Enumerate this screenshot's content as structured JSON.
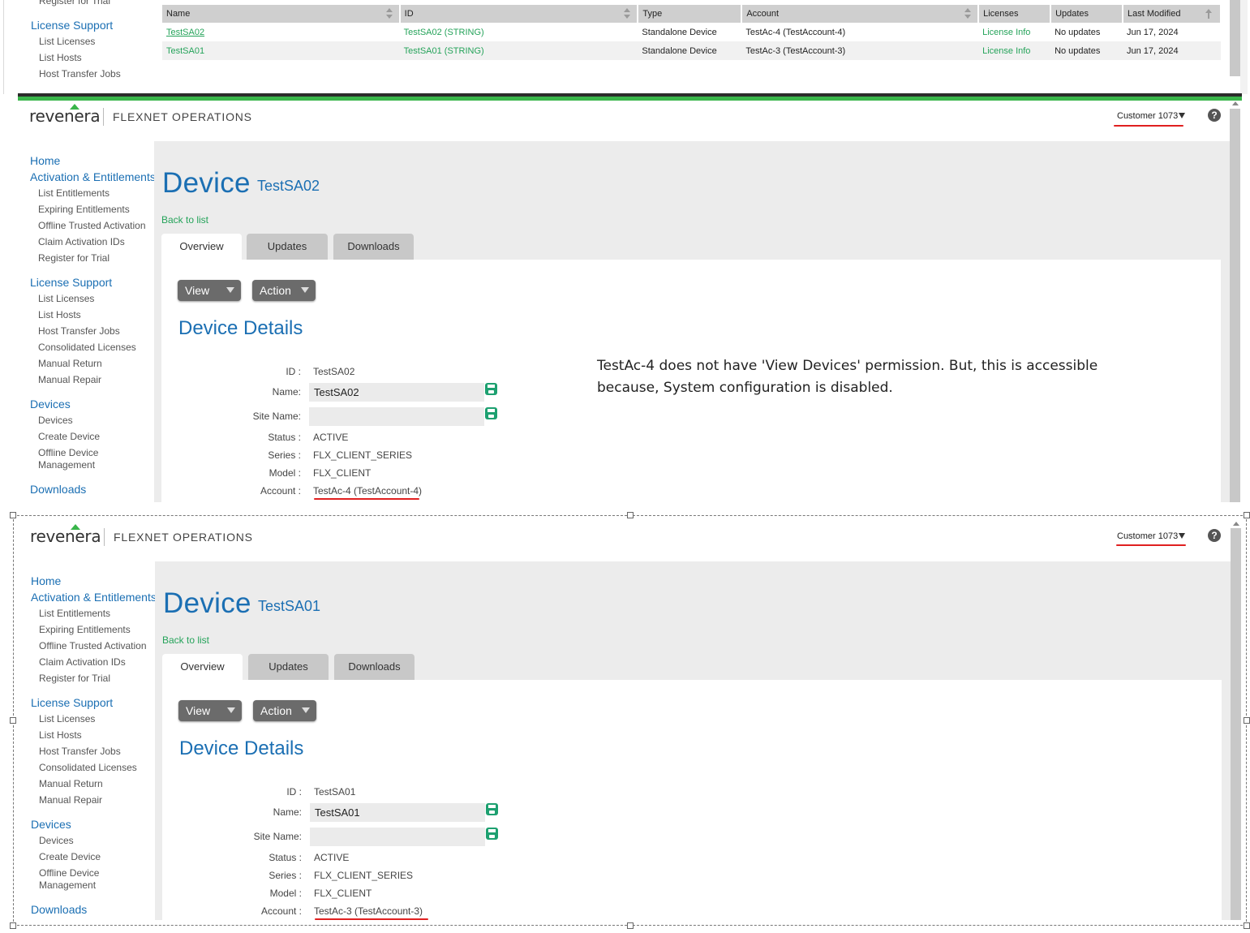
{
  "colors": {
    "link_blue": "#1b6fb3",
    "green": "#25a35a",
    "brand_green": "#39b54a",
    "annotation_red": "#e02020"
  },
  "list_view": {
    "nav": {
      "register_trial_cut": "Register for Trial",
      "section": "License Support",
      "items": [
        "List Licenses",
        "List Hosts",
        "Host Transfer Jobs"
      ]
    },
    "table": {
      "headers": [
        "Name",
        "ID",
        "Type",
        "Account",
        "Licenses",
        "Updates",
        "Last Modified"
      ],
      "rows": [
        {
          "name": "TestSA02",
          "id": "TestSA02 (STRING)",
          "type": "Standalone Device",
          "account": "TestAc-4 (TestAccount-4)",
          "licenses": "License Info",
          "updates": "No updates",
          "modified": "Jun 17, 2024"
        },
        {
          "name": "TestSA01",
          "id": "TestSA01 (STRING)",
          "type": "Standalone Device",
          "account": "TestAc-3 (TestAccount-3)",
          "licenses": "License Info",
          "updates": "No updates",
          "modified": "Jun 17, 2024"
        }
      ]
    }
  },
  "header": {
    "logo": "revenera",
    "product": "FLEXNET OPERATIONS",
    "customer": "Customer 1073",
    "help": "?"
  },
  "sidebar": {
    "home": "Home",
    "activation": "Activation & Entitlements",
    "activation_items": [
      "List Entitlements",
      "Expiring Entitlements",
      "Offline Trusted Activation",
      "Claim Activation IDs",
      "Register for Trial"
    ],
    "license_support": "License Support",
    "license_items": [
      "List Licenses",
      "List Hosts",
      "Host Transfer Jobs",
      "Consolidated Licenses",
      "Manual Return",
      "Manual Repair"
    ],
    "devices": "Devices",
    "device_items": [
      "Devices",
      "Create Device"
    ],
    "offline_device_1": "Offline Device",
    "offline_device_2": "Management",
    "downloads": "Downloads"
  },
  "page": {
    "title": "Device",
    "back": "Back to list",
    "tabs": [
      "Overview",
      "Updates",
      "Downloads"
    ],
    "view_btn": "View",
    "action_btn": "Action",
    "section": "Device Details",
    "labels": {
      "id": "ID :",
      "name": "Name:",
      "site": "Site Name:",
      "status": "Status :",
      "series": "Series :",
      "model": "Model :",
      "account": "Account :"
    }
  },
  "device1": {
    "subtitle": "TestSA02",
    "id": "TestSA02",
    "name": "TestSA02",
    "site": "",
    "status": "ACTIVE",
    "series": "FLX_CLIENT_SERIES",
    "model": "FLX_CLIENT",
    "account": "TestAc-4 (TestAccount-4)"
  },
  "device2": {
    "subtitle": "TestSA01",
    "id": "TestSA01",
    "name": "TestSA01",
    "site": "",
    "status": "ACTIVE",
    "series": "FLX_CLIENT_SERIES",
    "model": "FLX_CLIENT",
    "account": "TestAc-3 (TestAccount-3)"
  },
  "annotation": {
    "line1": "TestAc-4 does not have 'View Devices' permission. But, this is accessible",
    "line2": "because, System configuration is disabled."
  }
}
